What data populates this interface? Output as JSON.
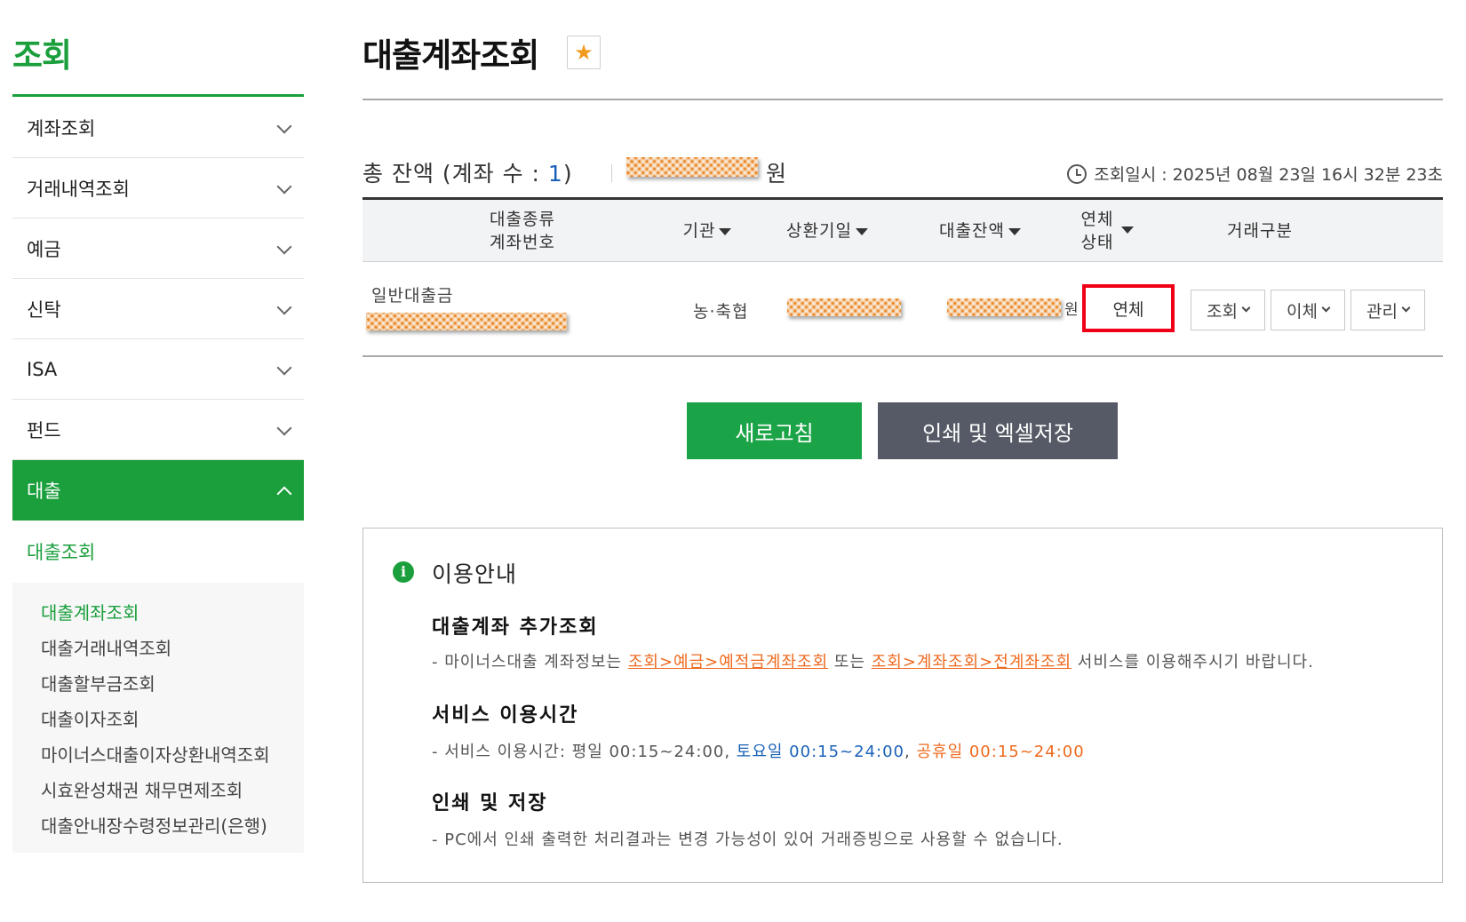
{
  "sidebar": {
    "title": "조회",
    "menu": [
      {
        "label": "계좌조회"
      },
      {
        "label": "거래내역조회"
      },
      {
        "label": "예금"
      },
      {
        "label": "신탁"
      },
      {
        "label": "ISA"
      },
      {
        "label": "펀드"
      },
      {
        "label": "대출"
      }
    ],
    "sub_head": "대출조회",
    "sub_items": [
      {
        "label": "대출계좌조회"
      },
      {
        "label": "대출거래내역조회"
      },
      {
        "label": "대출할부금조회"
      },
      {
        "label": "대출이자조회"
      },
      {
        "label": "마이너스대출이자상환내역조회"
      },
      {
        "label": "시효완성채권 채무면제조회"
      },
      {
        "label": "대출안내장수령정보관리(은행)"
      }
    ]
  },
  "page": {
    "title": "대출계좌조회",
    "favorite_icon": "star-icon"
  },
  "summary": {
    "total_label": "총 잔액 (계좌 수 : ",
    "count": "1",
    "close_paren": ")",
    "won": "원",
    "query_time": "조회일시 : 2025년 08월 23일 16시 32분 23초"
  },
  "table": {
    "headers": {
      "type_line1": "대출종류",
      "type_line2": "계좌번호",
      "institution": "기관",
      "repay_date": "상환기일",
      "balance": "대출잔액",
      "status_line1": "연체",
      "status_line2": "상태",
      "trade_type": "거래구분"
    },
    "rows": [
      {
        "loan_type": "일반대출금",
        "institution": "농·축협",
        "won": "원",
        "status": "연체",
        "actions": [
          "조회",
          "이체",
          "관리"
        ]
      }
    ]
  },
  "buttons": {
    "refresh": "새로고침",
    "print": "인쇄 및 엑셀저장"
  },
  "info": {
    "title": "이용안내",
    "section1_title": "대출계좌 추가조회",
    "section1_prefix": "- 마이너스대출 계좌정보는 ",
    "section1_link1": "조회>예금>예적금계좌조회",
    "section1_mid": " 또는 ",
    "section1_link2": "조회>계좌조회>전계좌조회",
    "section1_suffix": " 서비스를 이용해주시기 바랍니다.",
    "section2_title": "서비스 이용시간",
    "section2_prefix": "- 서비스 이용시간: 평일 00:15~24:00, ",
    "section2_sat": "토요일 00:15~24:00",
    "section2_comma": ", ",
    "section2_holiday": "공휴일 00:15~24:00",
    "section3_title": "인쇄 및 저장",
    "section3_text": "- PC에서 인쇄 출력한 처리결과는 변경 가능성이 있어 거래증빙으로 사용할 수 없습니다."
  },
  "colors": {
    "brand_green": "#1a9f3c",
    "alert_red": "#f00016",
    "link_orange": "#ee6a1f",
    "accent_blue": "#1a62b7",
    "print_button": "#555a66"
  }
}
